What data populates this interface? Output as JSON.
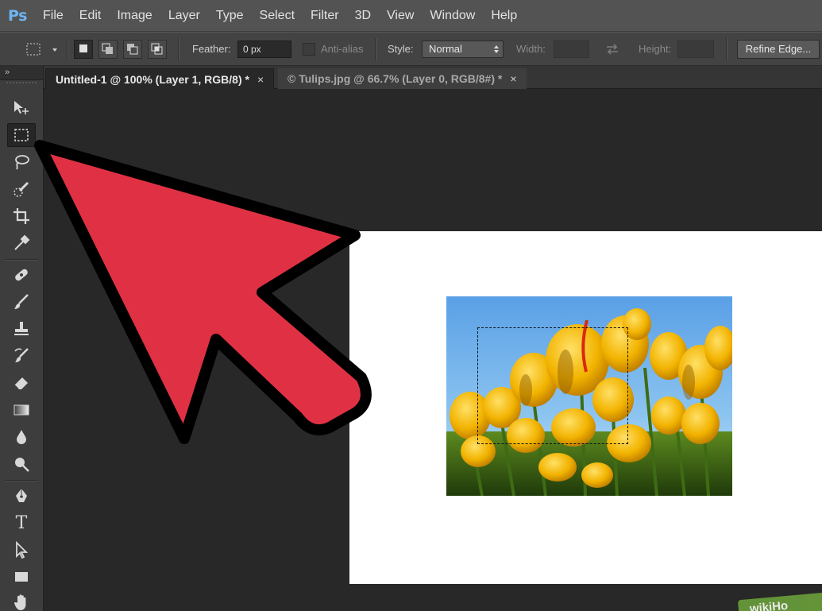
{
  "app": {
    "logo": "Ps"
  },
  "menu": [
    "File",
    "Edit",
    "Image",
    "Layer",
    "Type",
    "Select",
    "Filter",
    "3D",
    "View",
    "Window",
    "Help"
  ],
  "options": {
    "feather_label": "Feather:",
    "feather_value": "0 px",
    "antialias_label": "Anti-alias",
    "style_label": "Style:",
    "style_value": "Normal",
    "width_label": "Width:",
    "height_label": "Height:",
    "refine_edge": "Refine Edge..."
  },
  "tabs": [
    {
      "label": "Untitled-1 @ 100% (Layer 1, RGB/8) *",
      "close": "×"
    },
    {
      "label": "© Tulips.jpg @ 66.7% (Layer 0, RGB/8#) *",
      "close": "×"
    }
  ],
  "tools_header": "»",
  "tools": [
    "move",
    "rectangular-marquee",
    "lasso",
    "quick-selection",
    "crop",
    "eyedropper",
    "spot-healing-brush",
    "brush",
    "clone-stamp",
    "history-brush",
    "eraser",
    "gradient",
    "blur",
    "dodge",
    "pen",
    "type",
    "path-selection",
    "rectangle",
    "hand"
  ],
  "tool_type_glyph": "T",
  "watermark": "wikiHo",
  "colors": {
    "arrow": "#e03144",
    "accent": "#6cb6f2"
  }
}
